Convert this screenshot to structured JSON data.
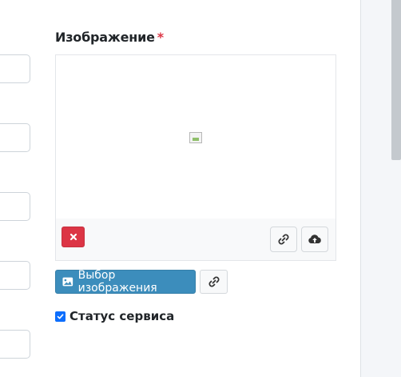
{
  "form": {
    "image_label": "Изображение",
    "required_mark": "*",
    "select_image_label": "Выбор изображения",
    "service_status_label": "Статус сервиса",
    "service_status_checked": true
  },
  "icons": {
    "remove": "close-icon",
    "url": "link-icon",
    "upload": "cloud-upload-icon",
    "select_image": "image-icon"
  },
  "colors": {
    "primary": "#3c8dbc",
    "danger": "#dc3545",
    "checkbox": "#0d6efd"
  }
}
